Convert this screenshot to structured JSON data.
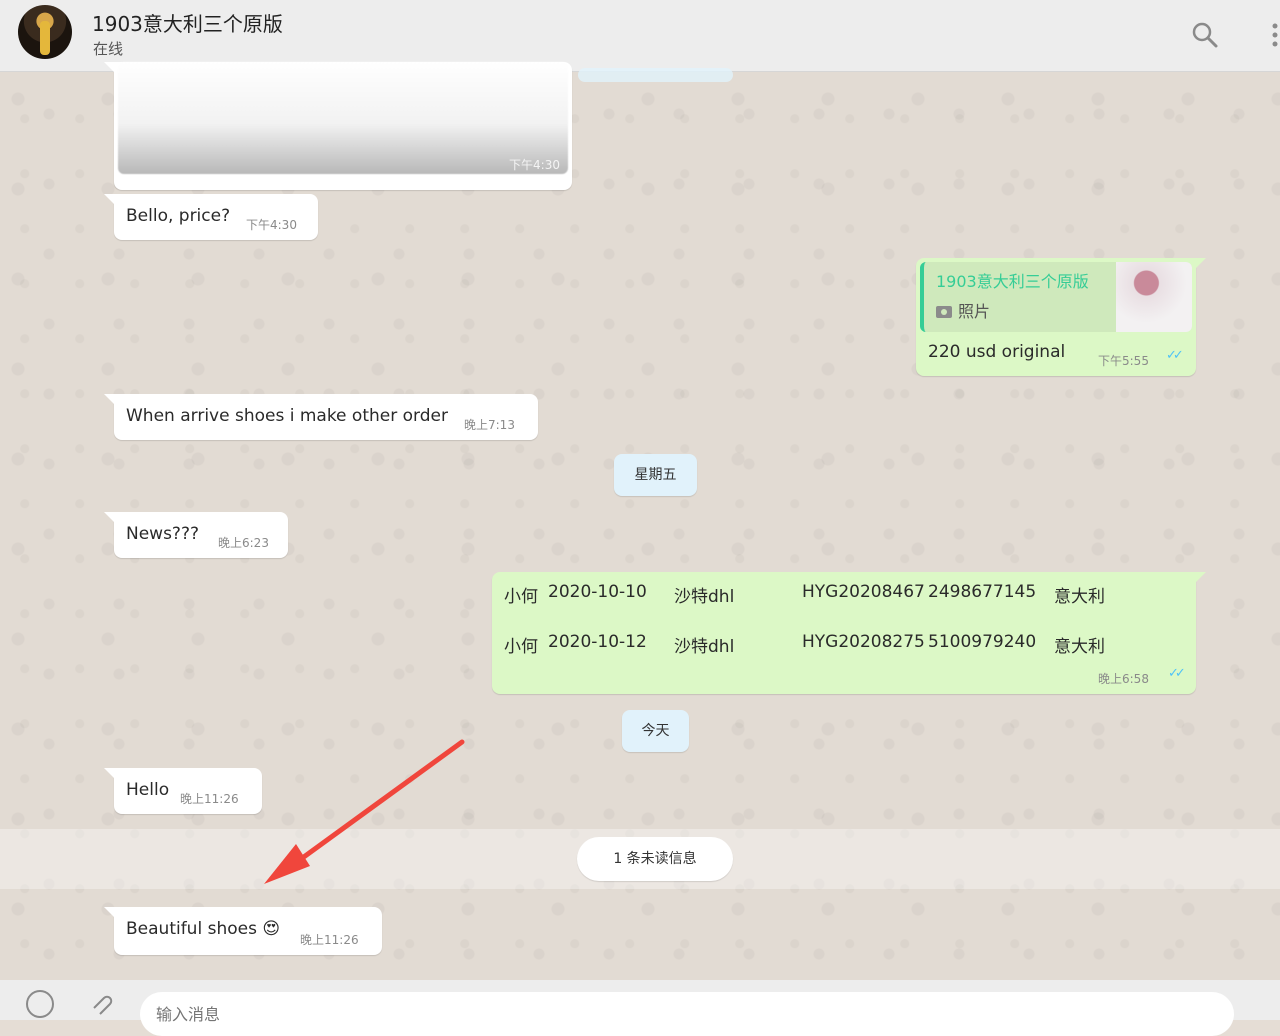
{
  "header": {
    "title": "1903意大利三个原版",
    "status": "在线",
    "icons": [
      "search-icon",
      "menu-icon"
    ]
  },
  "messages": {
    "image_msg": {
      "time": "下午4:30"
    },
    "m1": {
      "text": "Bello, price?",
      "time": "下午4:30"
    },
    "reply": {
      "quote_author": "1903意大利三个原版",
      "quote_body": "照片",
      "text": "220 usd original",
      "time": "下午5:55"
    },
    "m2": {
      "text": "When arrive shoes i make other order",
      "time": "晚上7:13"
    },
    "date1": "星期五",
    "m3": {
      "text": "News???",
      "time": "晚上6:23"
    },
    "shipments": {
      "rows": [
        {
          "name": "小何",
          "date": "2020-10-10",
          "carrier": "沙特dhl",
          "code": "HYG20208467",
          "tracking": "2498677145",
          "country": "意大利"
        },
        {
          "name": "小何",
          "date": "2020-10-12",
          "carrier": "沙特dhl",
          "code": "HYG20208275",
          "tracking": "5100979240",
          "country": "意大利"
        }
      ],
      "time": "晚上6:58"
    },
    "date2": "今天",
    "m4": {
      "text": "Hello",
      "time": "晚上11:26"
    },
    "unread": "1 条未读信息",
    "m5": {
      "text": "Beautiful shoes 😍",
      "time": "晚上11:26"
    }
  },
  "composer": {
    "placeholder": "输入消息"
  },
  "colors": {
    "incoming": "#ffffff",
    "outgoing": "#dcf8c6",
    "read_ticks": "#4fc3f7",
    "quote_accent": "#35cd96",
    "annotation_arrow": "#f0463c"
  }
}
